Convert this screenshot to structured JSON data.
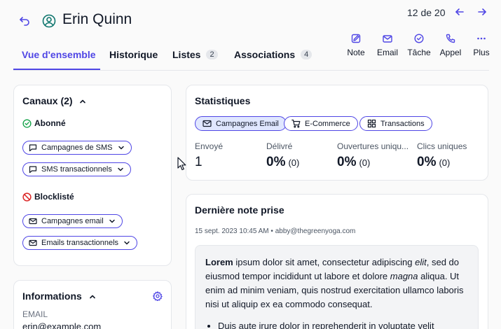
{
  "header": {
    "contact_name": "Erin Quinn",
    "pager": "12 de 20"
  },
  "tabs": [
    {
      "label": "Vue d'ensemble",
      "badge": ""
    },
    {
      "label": "Historique",
      "badge": ""
    },
    {
      "label": "Listes",
      "badge": "2"
    },
    {
      "label": "Associations",
      "badge": "4"
    }
  ],
  "actions": [
    {
      "label": "Note",
      "icon": "edit-icon"
    },
    {
      "label": "Email",
      "icon": "mail-icon"
    },
    {
      "label": "Tâche",
      "icon": "check-circle-icon"
    },
    {
      "label": "Appel",
      "icon": "phone-icon"
    },
    {
      "label": "Plus",
      "icon": "more-icon"
    }
  ],
  "channels": {
    "title": "Canaux (2)",
    "subscribed_label": "Abonné",
    "subscribed": [
      "Campagnes de SMS",
      "SMS transactionnels"
    ],
    "blocklisted_label": "Blocklisté",
    "blocklisted": [
      "Campagnes email",
      "Emails transactionnels"
    ]
  },
  "info": {
    "title": "Informations",
    "email_label": "EMAIL",
    "email_value": "erin@example.com"
  },
  "stats": {
    "title": "Statistiques",
    "chips": [
      "Campagnes Email",
      "E-Commerce",
      "Transactions"
    ],
    "metrics": [
      {
        "label": "Envoyé",
        "value": "1",
        "count": ""
      },
      {
        "label": "Délivré",
        "value": "0%",
        "count": "(0)"
      },
      {
        "label": "Ouvertures uniqu...",
        "value": "0%",
        "count": "(0)"
      },
      {
        "label": "Clics uniques",
        "value": "0%",
        "count": "(0)"
      }
    ]
  },
  "note": {
    "title": "Dernière note prise",
    "date": "15 sept. 2023 10:45 AM",
    "author": "abby@thegreenyoga.com",
    "lead_bold": "Lorem",
    "text_1": " ipsum dolor sit amet, consectetur adipiscing ",
    "italic_1": "elit",
    "text_2": ", sed do eiusmod tempor incididunt ut labore et dolore ",
    "italic_2": "magna",
    "text_3": " aliqua. Ut enim ad minim veniam, quis nostrud exercitation ullamco laboris nisi ut aliquip ex ea commodo consequat.",
    "bullet_1": "Duis aute irure dolor in reprehenderit in voluptate velit"
  },
  "colors": {
    "accent": "#4f46e5",
    "success": "#16a34a",
    "danger": "#dc2626"
  }
}
